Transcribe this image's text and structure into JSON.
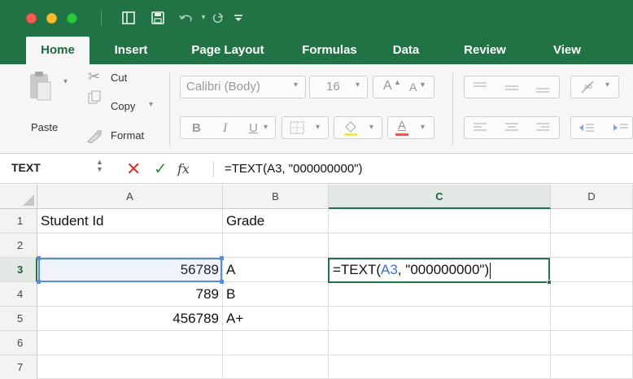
{
  "quick_access": {
    "icons": [
      "sidebar-icon",
      "save-icon",
      "undo-icon",
      "redo-icon",
      "customize-icon"
    ]
  },
  "tabs": [
    {
      "label": "Home",
      "active": true
    },
    {
      "label": "Insert",
      "active": false
    },
    {
      "label": "Page Layout",
      "active": false
    },
    {
      "label": "Formulas",
      "active": false
    },
    {
      "label": "Data",
      "active": false
    },
    {
      "label": "Review",
      "active": false
    },
    {
      "label": "View",
      "active": false
    }
  ],
  "ribbon": {
    "paste_label": "Paste",
    "cut_label": "Cut",
    "copy_label": "Copy",
    "format_label": "Format",
    "font_name": "Calibri (Body)",
    "font_size": "16",
    "bold": "B",
    "italic": "I",
    "underline": "U",
    "grow_font": "A",
    "shrink_font": "A"
  },
  "formula_bar": {
    "name_box": "TEXT",
    "fx": "fx",
    "formula": "=TEXT(A3, \"000000000\")"
  },
  "grid": {
    "columns": [
      "A",
      "B",
      "C",
      "D"
    ],
    "selected_column": "C",
    "rows": [
      "1",
      "2",
      "3",
      "4",
      "5",
      "6",
      "7"
    ],
    "selected_row": "3",
    "cells": {
      "A1": "Student Id",
      "B1": "Grade",
      "A3": "56789",
      "B3": "A",
      "A4": "789",
      "B4": "B",
      "A5": "456789",
      "B5": "A+"
    },
    "edit_cell": {
      "address": "C3",
      "prefix": "=TEXT(",
      "ref": "A3",
      "suffix": ", \"000000000\")"
    }
  },
  "colors": {
    "excel_green": "#217346",
    "reference_blue": "#3b6fd6"
  }
}
